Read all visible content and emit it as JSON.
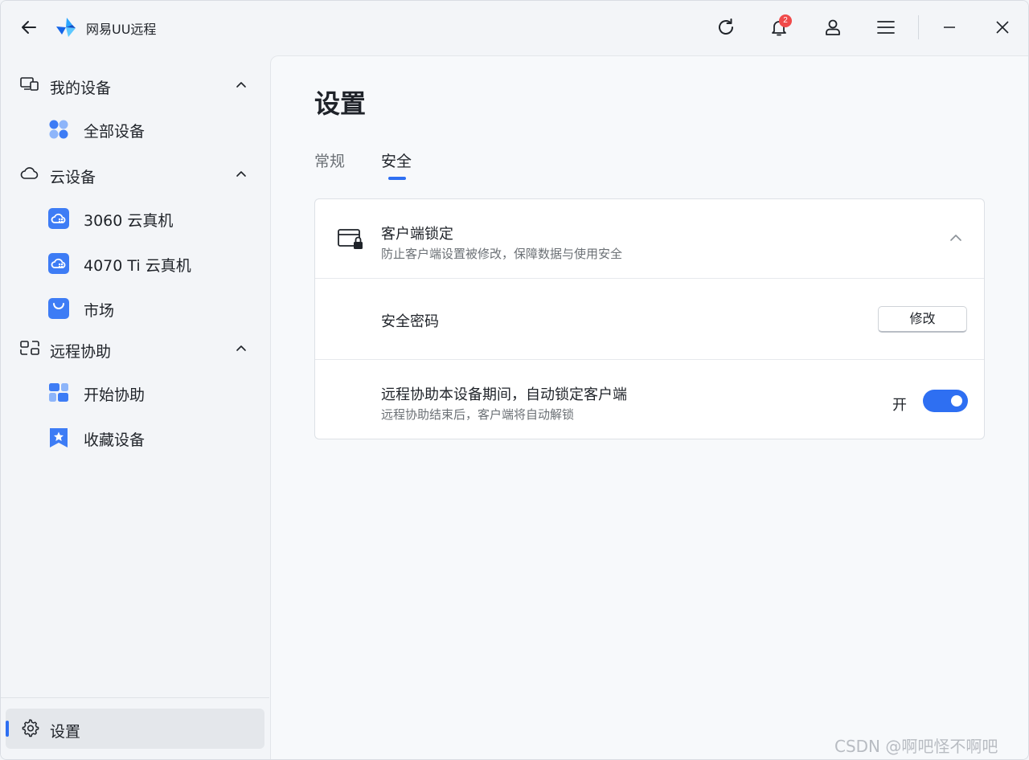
{
  "app": {
    "title": "网易UU远程"
  },
  "titlebar": {
    "notification_count": "2"
  },
  "sidebar": {
    "groups": [
      {
        "label": "我的设备",
        "items": [
          {
            "label": "全部设备"
          }
        ]
      },
      {
        "label": "云设备",
        "items": [
          {
            "label": "3060 云真机"
          },
          {
            "label": "4070 Ti 云真机"
          },
          {
            "label": "市场"
          }
        ]
      },
      {
        "label": "远程协助",
        "items": [
          {
            "label": "开始协助"
          },
          {
            "label": "收藏设备"
          }
        ]
      }
    ],
    "settings_label": "设置"
  },
  "main": {
    "page_title": "设置",
    "tabs": [
      {
        "label": "常规"
      },
      {
        "label": "安全",
        "active": true
      }
    ],
    "card": {
      "title": "客户端锁定",
      "subtitle": "防止客户端设置被修改，保障数据与使用安全",
      "password_row": {
        "label": "安全密码",
        "button": "修改"
      },
      "auto_lock_row": {
        "label": "远程协助本设备期间，自动锁定客户端",
        "sub": "远程协助结束后，客户端将自动解锁",
        "state_label": "开",
        "enabled": true
      }
    }
  },
  "watermark": "CSDN @啊吧怪不啊吧",
  "colors": {
    "accent": "#2e6ff2",
    "badge": "#f04a4a"
  }
}
